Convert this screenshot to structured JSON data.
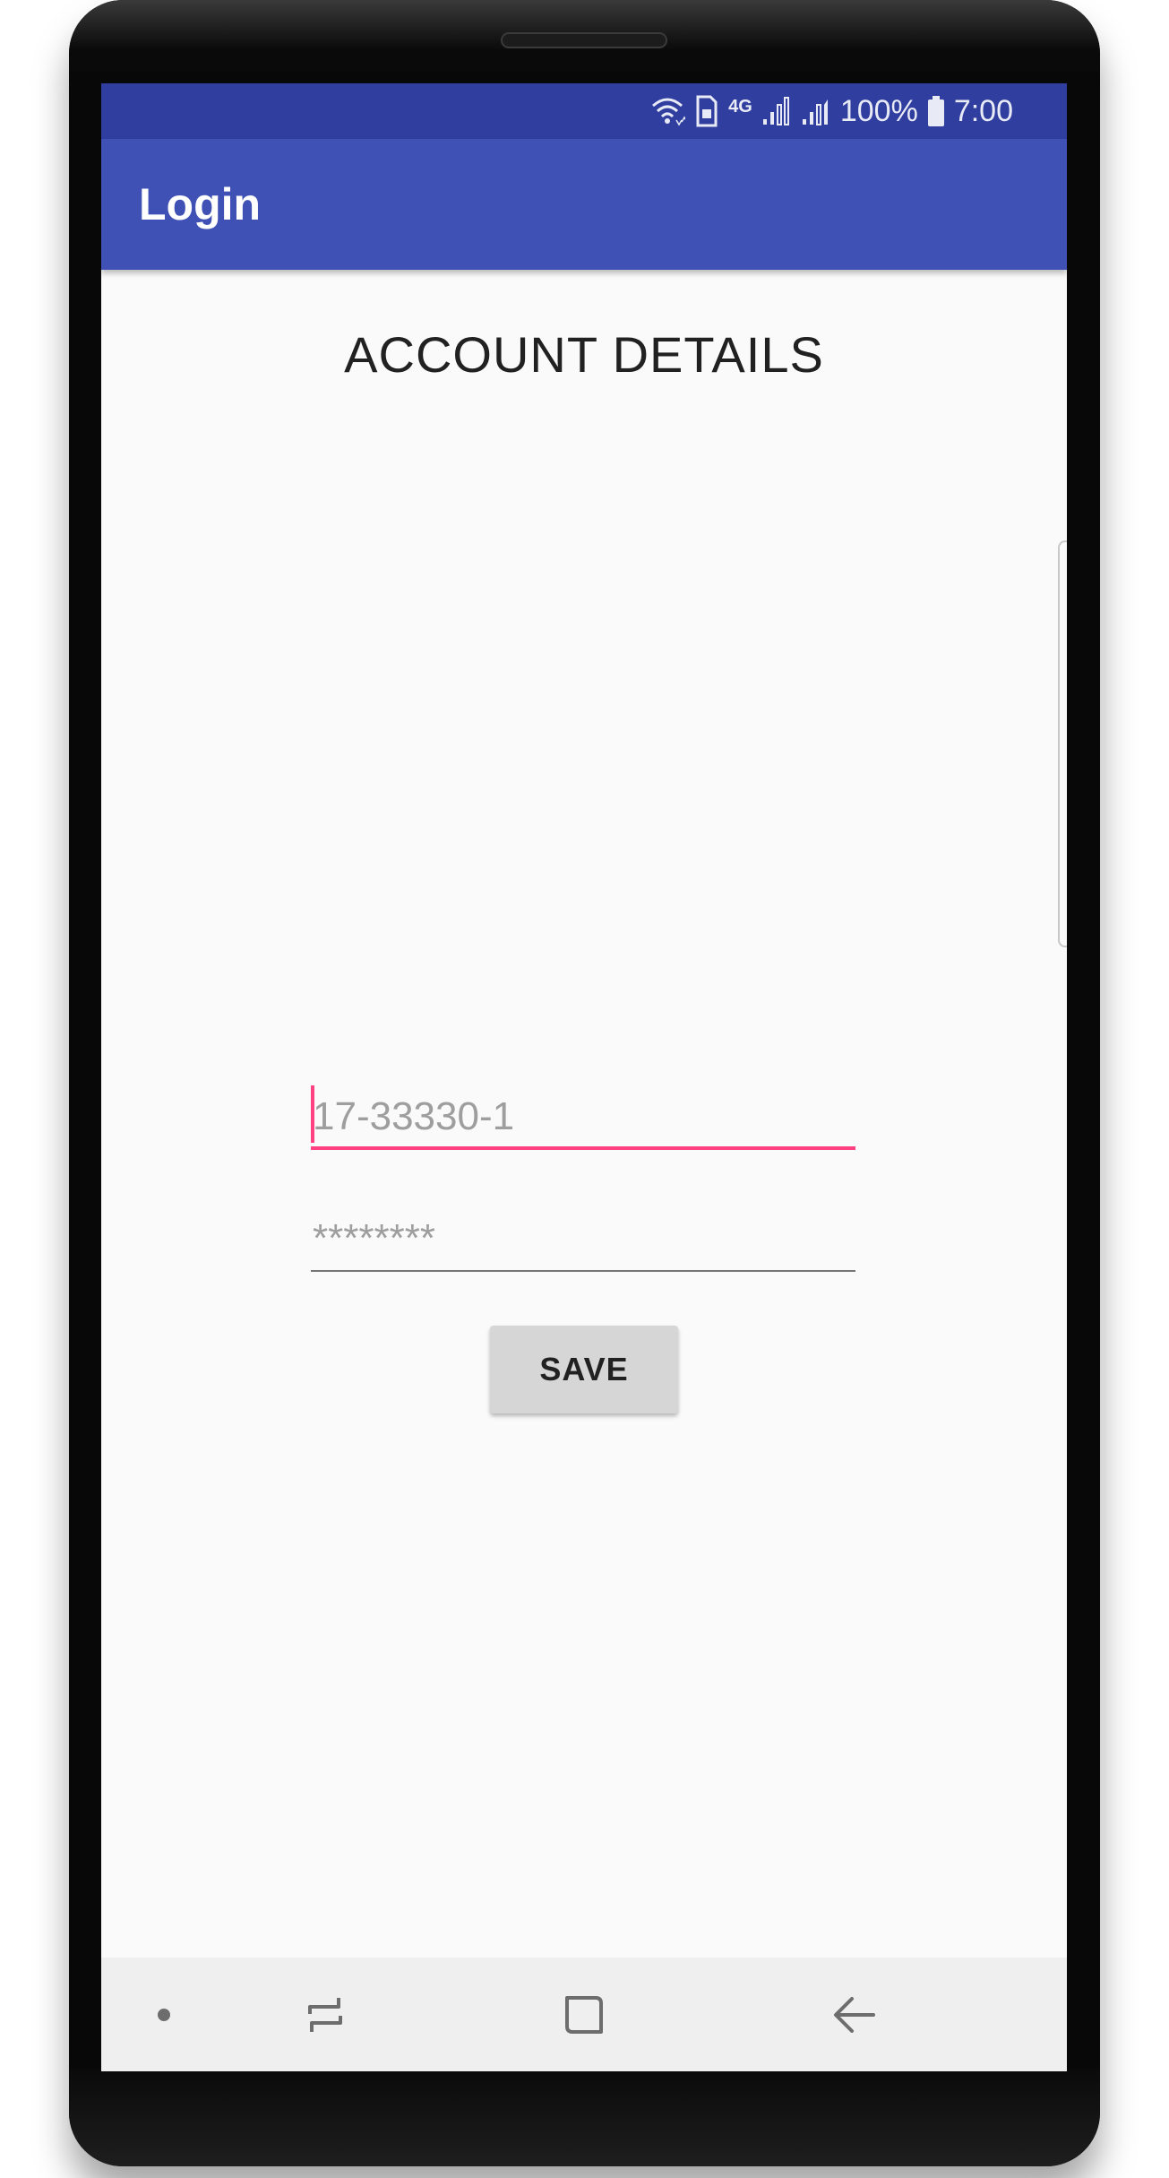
{
  "status_bar": {
    "icons": [
      "wifi-icon",
      "sim-icon",
      "4g-icon",
      "signal-icon",
      "signal-icon",
      "battery-icon"
    ],
    "network_label": "4G",
    "battery_text": "100%",
    "time": "7:00"
  },
  "app_bar": {
    "title": "Login"
  },
  "main": {
    "heading": "ACCOUNT DETAILS",
    "id_field": {
      "placeholder": "17-33330-1"
    },
    "password_field": {
      "placeholder": "********"
    },
    "save_label": "SAVE"
  },
  "nav_bar": {
    "icons": [
      "dot-icon",
      "recent-apps-icon",
      "home-icon",
      "back-icon"
    ]
  },
  "colors": {
    "status_bar": "#303f9f",
    "app_bar": "#3f51b5",
    "accent": "#ff4081",
    "background": "#fafafa",
    "button": "#d6d6d6"
  }
}
